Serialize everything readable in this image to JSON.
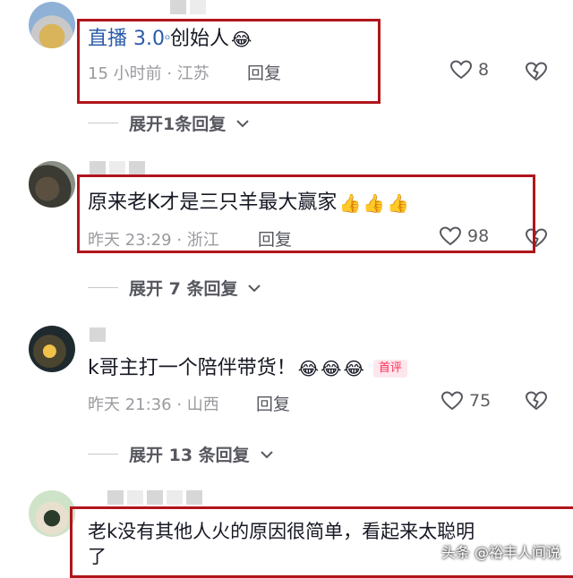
{
  "comments": [
    {
      "text_prefix": "直播 3.0",
      "text_rest": "创始人",
      "emojis": [
        "😂"
      ],
      "time": "15 小时前 · 江苏",
      "reply": "回复",
      "likes": "8",
      "replies_toggle": "展开1条回复"
    },
    {
      "text": "原来老K才是三只羊最大赢家",
      "emojis": [
        "👍",
        "👍",
        "👍"
      ],
      "time": "昨天 23:29 · 浙江",
      "reply": "回复",
      "likes": "98",
      "replies_toggle": "展开 7 条回复"
    },
    {
      "text": "k哥主打一个陪伴带货！",
      "emojis": [
        "😂",
        "😂",
        "😂"
      ],
      "badge": "首评",
      "time": "昨天 21:36 · 山西",
      "reply": "回复",
      "likes": "75",
      "replies_toggle": "展开 13 条回复"
    },
    {
      "text_line1": "老k没有其他人火的原因很简单，看起来太聪明",
      "text_line2": "了"
    }
  ],
  "watermark": "头条 @裕丰人间说",
  "colors": {
    "highlight_box": "#b0151b",
    "link": "#2b5ba9",
    "badge": "#fe2c55"
  }
}
